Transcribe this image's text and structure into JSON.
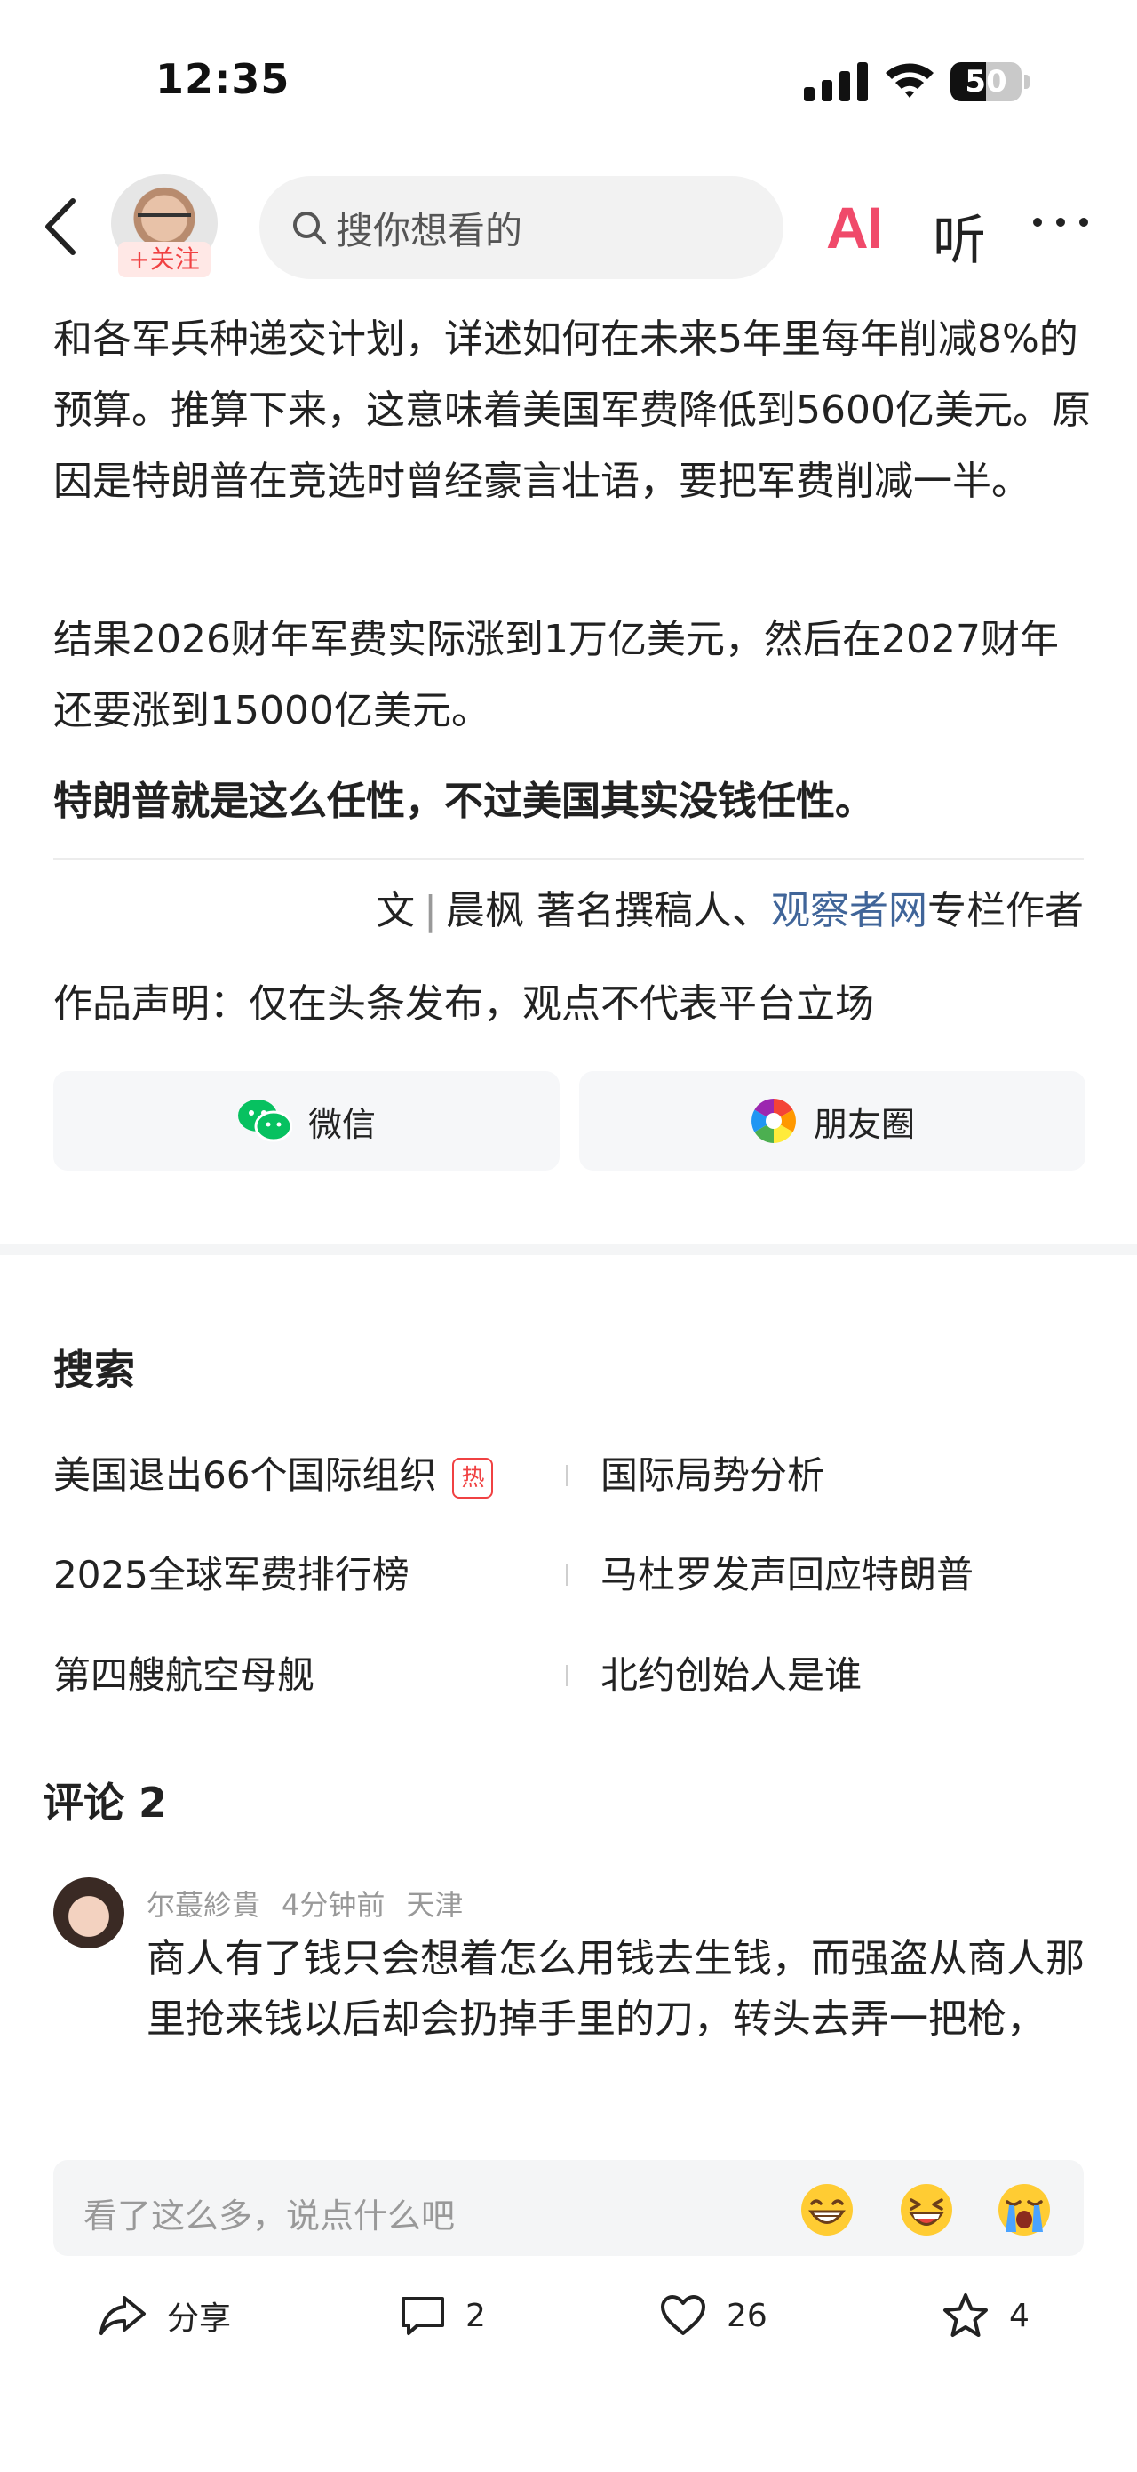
{
  "status_bar": {
    "time": "12:35",
    "battery": "50"
  },
  "nav": {
    "follow_label": "+关注",
    "search_placeholder": "搜你想看的",
    "ai_label": "AI",
    "listen_label": "听"
  },
  "article": {
    "paragraphs": [
      "和各军兵种递交计划，详述如何在未来5年里每年削减8%的预算。推算下来，这意味着美国军费降低到5600亿美元。原因是特朗普在竞选时曾经豪言壮语，要把军费削减一半。",
      "结果2026财年军费实际涨到1万亿美元，然后在2027财年还要涨到15000亿美元。",
      "特朗普就是这么任性，不过美国其实没钱任性。"
    ],
    "credit": {
      "prefix": "文",
      "author": "晨枫 著名撰稿人、",
      "outlet": "观察者网",
      "suffix": "专栏作者"
    },
    "declaration": "作品声明：仅在头条发布，观点不代表平台立场"
  },
  "share": {
    "wechat": "微信",
    "moments": "朋友圈"
  },
  "search_section": {
    "title": "搜索",
    "hot_badge": "热",
    "items": [
      "美国退出66个国际组织",
      "国际局势分析",
      "2025全球军费排行榜",
      "马杜罗发声回应特朗普",
      "第四艘航空母舰",
      "北约创始人是谁"
    ]
  },
  "comments": {
    "title": "评论 2",
    "list": [
      {
        "user": "尔蕞紾貴",
        "time": "4分钟前",
        "location": "天津",
        "text": "商人有了钱只会想着怎么用钱去生钱，而强盗从商人那里抢来钱以后却会扔掉手里的刀，转头去弄一把枪，"
      }
    ]
  },
  "comment_input": {
    "placeholder": "看了这么多，说点什么吧"
  },
  "actions": {
    "share_label": "分享",
    "comment_count": "2",
    "like_count": "26",
    "favorite_count": "4"
  },
  "colors": {
    "accent_red": "#f04142",
    "link_blue": "#406599",
    "wechat_green": "#07c160",
    "ai_pink": "#f04a6a"
  }
}
